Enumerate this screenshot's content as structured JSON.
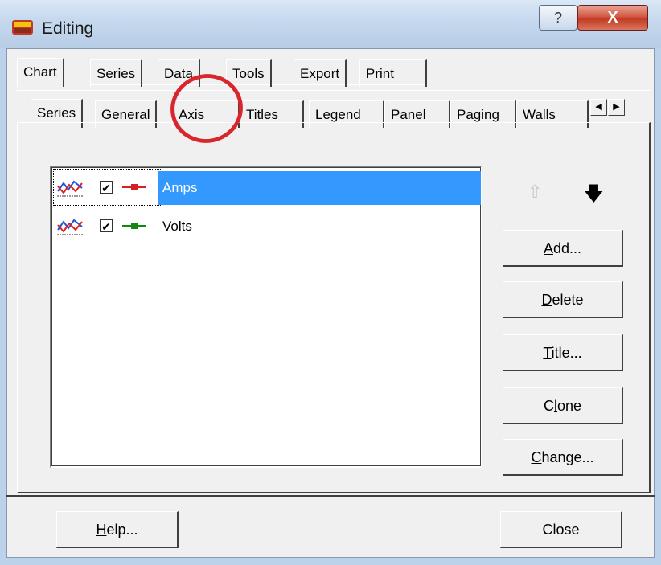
{
  "window": {
    "title": "Editing",
    "help_glyph": "?",
    "close_glyph": "X"
  },
  "tabs_row1": [
    {
      "label": "Chart",
      "active": true
    },
    {
      "label": "Series"
    },
    {
      "label": "Data"
    },
    {
      "label": "Tools"
    },
    {
      "label": "Export"
    },
    {
      "label": "Print"
    }
  ],
  "tabs_row2": [
    {
      "label": "Series",
      "active": true
    },
    {
      "label": "General"
    },
    {
      "label": "Axis"
    },
    {
      "label": "Titles"
    },
    {
      "label": "Legend"
    },
    {
      "label": "Panel"
    },
    {
      "label": "Paging"
    },
    {
      "label": "Walls"
    }
  ],
  "tab_scroll": {
    "left": "◀",
    "right": "▶"
  },
  "series_list": [
    {
      "label": "Amps",
      "checked": true,
      "color": "#d42020",
      "selected": true
    },
    {
      "label": "Volts",
      "checked": true,
      "color": "#118811",
      "selected": false
    }
  ],
  "side_buttons": {
    "add": {
      "mn": "A",
      "rest": "dd..."
    },
    "delete": {
      "mn": "D",
      "rest": "elete"
    },
    "title": {
      "mn": "T",
      "rest": "itle..."
    },
    "clone": {
      "pre": "C",
      "mn": "l",
      "rest": "one"
    },
    "change": {
      "mn": "C",
      "rest": "hange..."
    }
  },
  "move_arrows": {
    "up": "⇧",
    "down": "🡇"
  },
  "bottom": {
    "help": {
      "mn": "H",
      "rest": "elp..."
    },
    "close": "Close"
  },
  "colors": {
    "selection": "#3399ff",
    "annotation": "#d8262c"
  }
}
